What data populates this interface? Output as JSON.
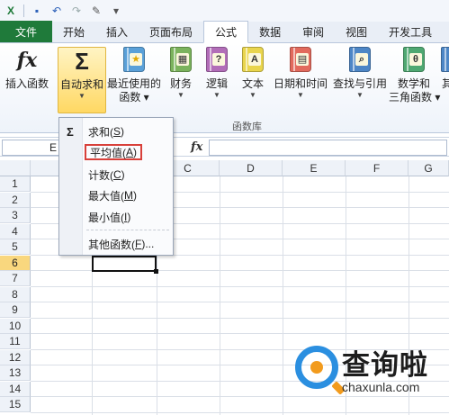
{
  "qat": {
    "icons": [
      "save-icon",
      "undo-icon",
      "redo-icon",
      "tool-icon"
    ]
  },
  "tabs": [
    "文件",
    "开始",
    "插入",
    "页面布局",
    "公式",
    "数据",
    "审阅",
    "视图",
    "开发工具"
  ],
  "active_tab": "公式",
  "ribbon": {
    "buttons": [
      {
        "label": "插入函数",
        "icon": "fx-icon"
      },
      {
        "label": "自动求和",
        "icon": "sigma-icon",
        "selected": true
      },
      {
        "label": "最近使用的\n函数",
        "icon": "star-book-icon"
      },
      {
        "label": "财务",
        "icon": "finance-book-icon"
      },
      {
        "label": "逻辑",
        "icon": "logic-book-icon"
      },
      {
        "label": "文本",
        "icon": "text-book-icon"
      },
      {
        "label": "日期和时间",
        "icon": "date-book-icon"
      },
      {
        "label": "查找与引用",
        "icon": "lookup-book-icon"
      },
      {
        "label": "数学和\n三角函数",
        "icon": "math-book-icon"
      },
      {
        "label": "其",
        "icon": "more-book-icon"
      }
    ],
    "group_label": "函数库"
  },
  "formula_bar": {
    "namebox": "E",
    "fx": "fx"
  },
  "columns": [
    "B",
    "C",
    "D",
    "E",
    "F",
    "G"
  ],
  "rows": [
    "1",
    "2",
    "3",
    "4",
    "5",
    "6",
    "7",
    "8",
    "9",
    "10",
    "11",
    "12",
    "13",
    "14",
    "15"
  ],
  "active_row": "6",
  "dropdown": {
    "items": [
      {
        "label": "求和(S)",
        "key": "S"
      },
      {
        "label": "平均值(A)",
        "key": "A",
        "highlighted": true
      },
      {
        "label": "计数(C)",
        "key": "C"
      },
      {
        "label": "最大值(M)",
        "key": "M"
      },
      {
        "label": "最小值(I)",
        "key": "I"
      },
      {
        "label": "其他函数(F)...",
        "key": "F"
      }
    ]
  },
  "watermark": {
    "text": "查询啦",
    "url": "chaxunla.com"
  },
  "colors": {
    "file_tab": "#1f7a3a",
    "highlight": "#d8403a",
    "selected_button": "#ffd863"
  }
}
